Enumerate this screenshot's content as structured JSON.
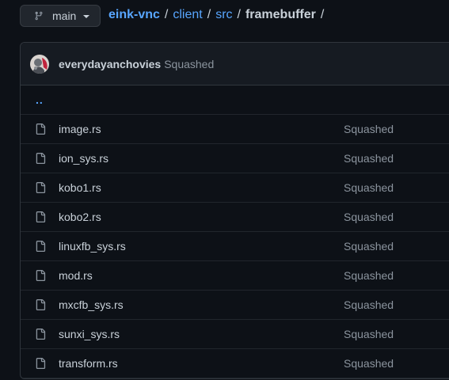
{
  "branch": {
    "name": "main"
  },
  "breadcrumb": {
    "repo": "eink-vnc",
    "parts": [
      "client",
      "src"
    ],
    "current": "framebuffer",
    "trailing": "/"
  },
  "commit": {
    "author": "everydayanchovies",
    "message": "Squashed"
  },
  "parent_dir": {
    "label": ".."
  },
  "files": [
    {
      "name": "image.rs",
      "message": "Squashed"
    },
    {
      "name": "ion_sys.rs",
      "message": "Squashed"
    },
    {
      "name": "kobo1.rs",
      "message": "Squashed"
    },
    {
      "name": "kobo2.rs",
      "message": "Squashed"
    },
    {
      "name": "linuxfb_sys.rs",
      "message": "Squashed"
    },
    {
      "name": "mod.rs",
      "message": "Squashed"
    },
    {
      "name": "mxcfb_sys.rs",
      "message": "Squashed"
    },
    {
      "name": "sunxi_sys.rs",
      "message": "Squashed"
    },
    {
      "name": "transform.rs",
      "message": "Squashed"
    }
  ],
  "icons": {
    "branch": "git-branch-icon",
    "file": "file-icon",
    "caret": "caret-down-icon"
  },
  "colors": {
    "link": "#58a6ff",
    "background": "#0d1117",
    "muted": "#8b949e"
  }
}
